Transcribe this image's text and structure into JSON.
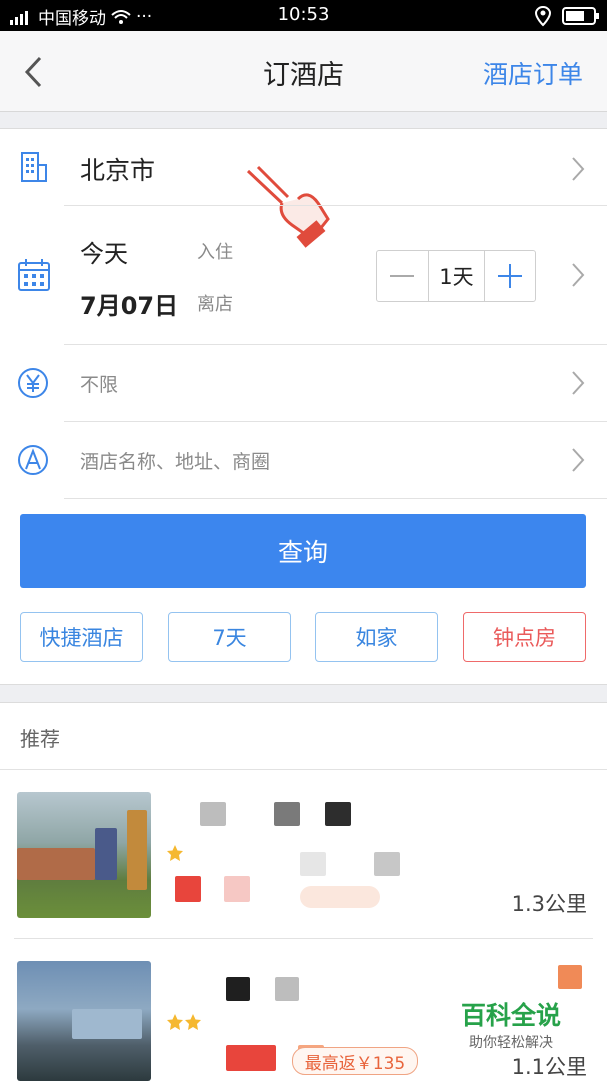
{
  "status_bar": {
    "carrier": "中国移动",
    "dots": "···",
    "time": "10:53"
  },
  "nav": {
    "title": "订酒店",
    "orders_link": "酒店订单"
  },
  "form": {
    "city": "北京市",
    "checkin_label": "今天",
    "checkin_tag": "入住",
    "checkout_label": "7月07日",
    "checkout_tag": "离店",
    "nights": "1天",
    "price_placeholder": "不限",
    "keyword_placeholder": "酒店名称、地址、商圈",
    "query_button": "查询",
    "quick_tags": [
      "快捷酒店",
      "7天",
      "如家",
      "钟点房"
    ]
  },
  "recommend": {
    "title": "推荐",
    "items": [
      {
        "distance": "1.3公里"
      },
      {
        "distance": "1.1公里",
        "cashback": "最高返￥135"
      }
    ]
  },
  "watermark": {
    "title": "百科全说",
    "subtitle": "助你轻松解决"
  },
  "colors": {
    "accent": "#3c86ee",
    "red": "#ea5a5a"
  }
}
